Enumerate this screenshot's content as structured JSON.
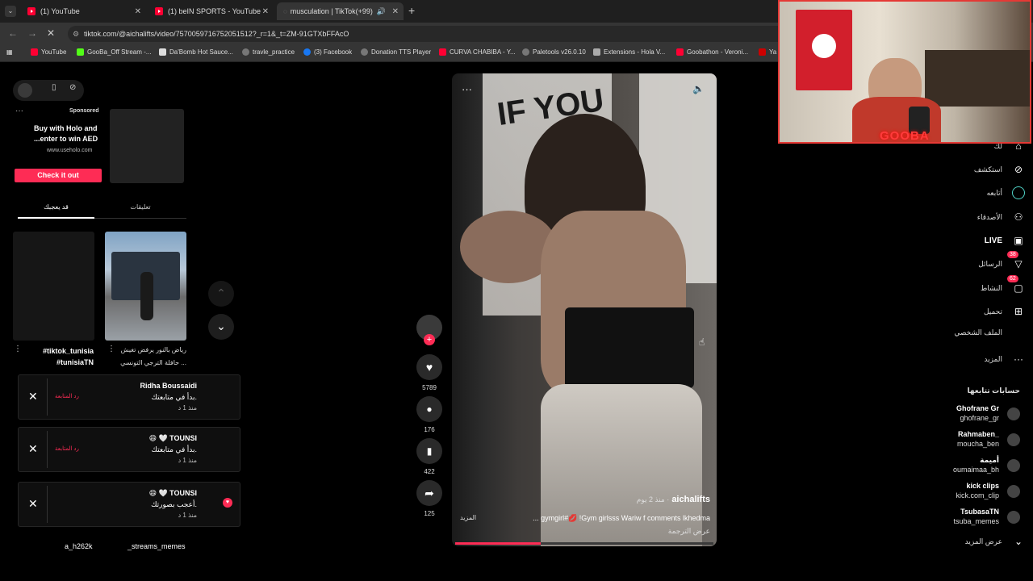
{
  "browser": {
    "tabs": [
      {
        "title": "(1) YouTube"
      },
      {
        "title": "(1) beIN SPORTS - YouTube"
      },
      {
        "title": "musculation | TikTok(+99)"
      }
    ],
    "url": "tiktok.com/@aichalifts/video/7570059716752051512?_r=1&_t=ZM-91GTXbFFAcO",
    "bookmarks": [
      "YouTube",
      "GooBa_Off Stream -...",
      "Da'Bomb Hot Sauce...",
      "travle_practice",
      "(3) Facebook",
      "Donation TTS Player",
      "CURVA CHABIBA - Y...",
      "Paletools v26.0.10",
      "Extensions - Hola V...",
      "Goobathon - Veroni...",
      "Ya"
    ]
  },
  "ad": {
    "sponsored": "Sponsored",
    "title_line1": "Buy with Holo and",
    "title_line2": "...enter to win AED",
    "domain": "www.useholo.com",
    "cta": "Check it out"
  },
  "left_tabs": {
    "tab1": "قد يعجبك",
    "tab2": "تعليقات"
  },
  "thumbs": [
    {
      "caption": "#tiktok_tunisia #tunisiaTN"
    },
    {
      "caption_line1": "رياض بالنور يرفض تغيش",
      "caption_line2": "حافلة الترجي التونسي ..."
    }
  ],
  "notifications": [
    {
      "name": "Ridha Boussaidi",
      "message": "بدأ في متابعتك.",
      "time": "منذ 1 د",
      "action": "رد المتابعة"
    },
    {
      "name": "😄 🤍 TOUNSI",
      "message": "بدأ في متابعتك.",
      "time": "منذ 1 د",
      "action": "رد المتابعة"
    },
    {
      "name": "😄 🤍 TOUNSI",
      "message": "أعجب بصورتك.",
      "time": "منذ 1 د",
      "action": ""
    }
  ],
  "bottom_users": [
    "a_h262k",
    "_streams_memes"
  ],
  "video": {
    "author": "aichalifts",
    "posted": "منذ 2 يوم ·",
    "caption": "... gymgirl#💋 !Gym girlsss Wariw f comments lkhedma",
    "more": "المزيد",
    "translate": "عرض الترجمة",
    "overlay_text": "IF YOU",
    "progress": 0.33
  },
  "actions": {
    "likes": "5789",
    "comments": "176",
    "saves": "422",
    "shares": "125"
  },
  "sidebar": {
    "items": [
      {
        "label": "لك",
        "icon": "home-icon"
      },
      {
        "label": "استكشف",
        "icon": "compass-icon"
      },
      {
        "label": "أتابعه",
        "icon": "following-icon"
      },
      {
        "label": "الأصدقاء",
        "icon": "friends-icon"
      },
      {
        "label": "LIVE",
        "icon": "live-icon"
      },
      {
        "label": "الرسائل",
        "icon": "messages-icon",
        "badge": "38"
      },
      {
        "label": "النشاط",
        "icon": "activity-icon",
        "badge": "62"
      },
      {
        "label": "تحميل",
        "icon": "upload-icon"
      },
      {
        "label": "الملف الشخصي",
        "icon": "profile-icon"
      },
      {
        "label": "المزيد",
        "icon": "more-icon"
      }
    ],
    "following_title": "حسابات تتابعها",
    "following": [
      {
        "name": "Ghofrane Gr",
        "handle": "ghofrane_gr"
      },
      {
        "name": "Rahmaben_",
        "handle": "moucha_ben"
      },
      {
        "name": "أميمة",
        "handle": "oumaimaa_bh"
      },
      {
        "name": "kick clips",
        "handle": "kick.com_clip"
      },
      {
        "name": "TsubasaTN",
        "handle": "tsuba_memes"
      }
    ],
    "show_more": "عرض المزيد"
  },
  "webcam": {
    "overlay": "GOOBA"
  },
  "colors": {
    "accent": "#fe2c55",
    "youtube": "#ff0033"
  }
}
